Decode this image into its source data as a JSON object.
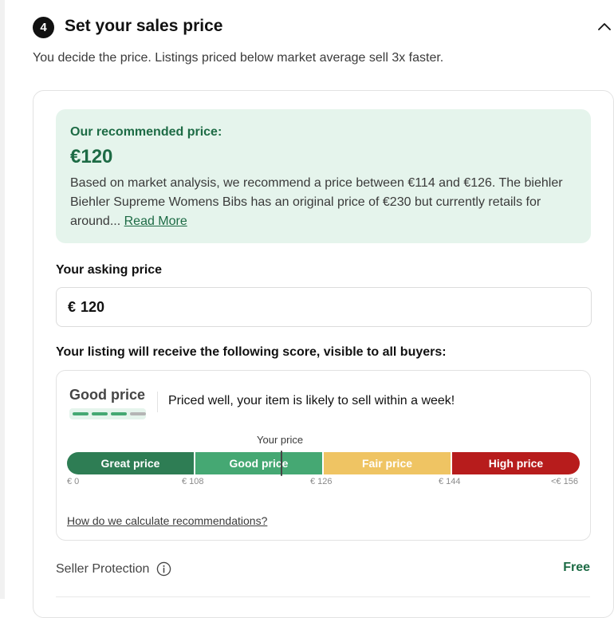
{
  "step": {
    "number": "4",
    "title": "Set your sales price",
    "subtitle": "You decide the price. Listings priced below market average sell 3x faster.",
    "collapse_icon": "chevron-up-icon"
  },
  "recommendation": {
    "heading": "Our recommended price:",
    "price": "€120",
    "body": "Based on market analysis, we recommend a price between €114 and €126. The biehler Biehler Supreme Womens Bibs has an original price of €230 but currently retails for around...",
    "read_more": "Read More"
  },
  "asking_price": {
    "label": "Your asking price",
    "currency": "€",
    "value": "120"
  },
  "score": {
    "label": "Your listing will receive the following score, visible to all buyers:",
    "rating": "Good price",
    "rating_level": 3,
    "rating_max": 4,
    "description": "Priced well, your item is likely to sell within a week!",
    "your_price_label": "Your price",
    "segments": [
      {
        "label": "Great price",
        "color": "#2e7d54"
      },
      {
        "label": "Good price",
        "color": "#45a873"
      },
      {
        "label": "Fair price",
        "color": "#efc463"
      },
      {
        "label": "High price",
        "color": "#b71c1c"
      }
    ],
    "ticks": [
      "€ 0",
      "€ 108",
      "€ 126",
      "€ 144",
      "<€ 156"
    ],
    "calc_link": "How do we calculate recommendations?"
  },
  "protection": {
    "label": "Seller Protection",
    "info_icon": "info-icon",
    "price": "Free"
  },
  "colors": {
    "accent_green": "#1d6b45",
    "recommend_bg": "#e5f4ec",
    "rating_bar_on": "#45a873",
    "rating_bar_off": "#b5b5b5"
  }
}
